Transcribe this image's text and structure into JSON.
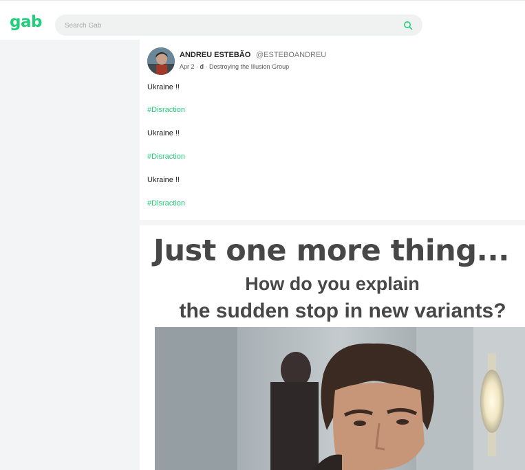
{
  "header": {
    "logo": "gab",
    "search_placeholder": "Search Gab",
    "search_icon": "search-icon"
  },
  "post": {
    "author_name": "ANDREU ESTEBÃO",
    "author_handle": "@ESTEBOANDREU",
    "meta_date": "Apr 2 ·",
    "meta_icon": "đ",
    "meta_group": "· Destroying the Illusion Group",
    "lines": [
      {
        "type": "text",
        "value": "Ukraine !!"
      },
      {
        "type": "hashtag",
        "value": "#Disraction"
      },
      {
        "type": "text",
        "value": "Ukraine !!"
      },
      {
        "type": "hashtag",
        "value": "#Disraction"
      },
      {
        "type": "text",
        "value": "Ukraine !!"
      },
      {
        "type": "hashtag",
        "value": "#Disraction"
      }
    ],
    "meme": {
      "line1": "Just one more thing...",
      "line2": "How do you explain",
      "line3": "the sudden stop in new variants?"
    }
  },
  "colors": {
    "brand_green": "#21cf7a",
    "sidebar_bg": "#f3f4f5",
    "meme_text": "#474747"
  }
}
